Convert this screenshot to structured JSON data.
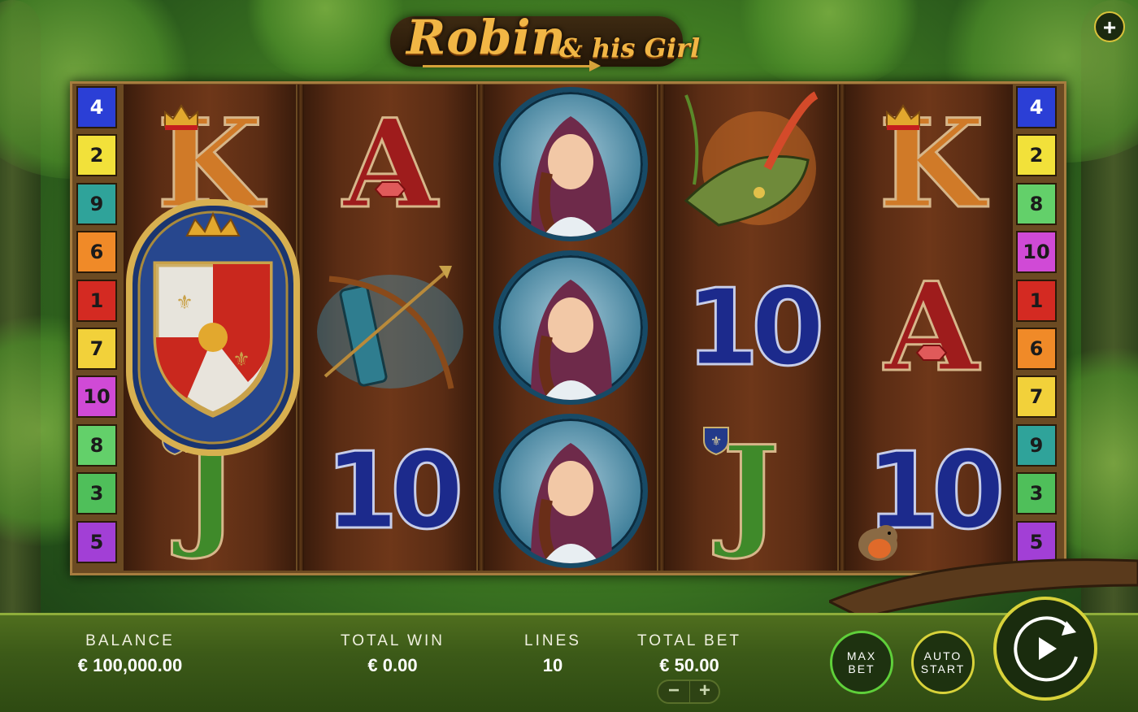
{
  "logo": {
    "main": "Robin",
    "amp": "&",
    "sub": "his Girl"
  },
  "menu_button": "+",
  "paylines_left": [
    "4",
    "2",
    "9",
    "6",
    "1",
    "7",
    "10",
    "8",
    "3",
    "5"
  ],
  "paylines_right": [
    "4",
    "2",
    "8",
    "10",
    "1",
    "6",
    "7",
    "9",
    "3",
    "5"
  ],
  "payline_colors": {
    "1": "#d42a22",
    "2": "#f2e13a",
    "3": "#4fbf5a",
    "4": "#2b3fd6",
    "5": "#a23fd6",
    "6": "#f08a28",
    "7": "#f2d13a",
    "8": "#63d06a",
    "9": "#2fa39a",
    "10": "#d04ad6"
  },
  "reels": [
    [
      "K",
      "shield-wild",
      "J"
    ],
    [
      "A",
      "bow-quiver",
      "10"
    ],
    [
      "girl-scatter",
      "girl-scatter",
      "girl-scatter"
    ],
    [
      "hat",
      "10",
      "J"
    ],
    [
      "K",
      "A",
      "10"
    ]
  ],
  "symbol_text": {
    "K": "K",
    "A": "A",
    "J": "J",
    "ten": "10"
  },
  "bottom_bar": {
    "balance_label": "BALANCE",
    "balance_value": "€ 100,000.00",
    "total_win_label": "TOTAL WIN",
    "total_win_value": "€ 0.00",
    "lines_label": "LINES",
    "lines_value": "10",
    "total_bet_label": "TOTAL BET",
    "total_bet_value": "€ 50.00",
    "bet_minus": "−",
    "bet_plus": "+",
    "max_bet_line1": "MAX",
    "max_bet_line2": "BET",
    "auto_start_line1": "AUTO",
    "auto_start_line2": "START"
  },
  "accent_colors": {
    "spin_ring": "#d8d23a",
    "max_bet_ring": "#5fd03a",
    "auto_start_ring": "#d8d23a"
  }
}
